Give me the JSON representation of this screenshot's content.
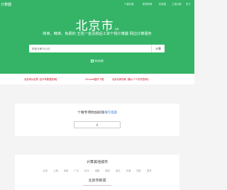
{
  "topbar": {
    "logo": "计算器",
    "nav": [
      "个税计算",
      "房贷利率",
      "年终奖",
      "工资计算",
      "关于"
    ]
  },
  "hero": {
    "city": "北京市",
    "city_switch": "切换",
    "tagline": "简单、精准、免费的 五险一金及税后工资个税计算器 网边计算服务",
    "search": {
      "placeholder": "税前月薪(元)/月",
      "button": "计算"
    },
    "favorite": "添加收藏"
  },
  "ads": [
    "北京房价走势【近5年数据查询】",
    "Chrome插件下载",
    "北京买房贷款【输入个人情况查询】"
  ],
  "calc_panel": {
    "title": "个税专项附加扣除",
    "link": "填写指南",
    "amount_value": "0"
  },
  "other_cities": {
    "title": "计算其他城市",
    "cities": [
      "北京",
      "上海",
      "深圳",
      "广州",
      "杭州",
      "成都",
      "南京",
      "武汉",
      "天津",
      "西安",
      "更多"
    ],
    "news_title": "北京市新闻"
  },
  "colors": {
    "brand_green": "#35b468",
    "ad_red": "#d0021b",
    "link_blue": "#3a79d6"
  }
}
